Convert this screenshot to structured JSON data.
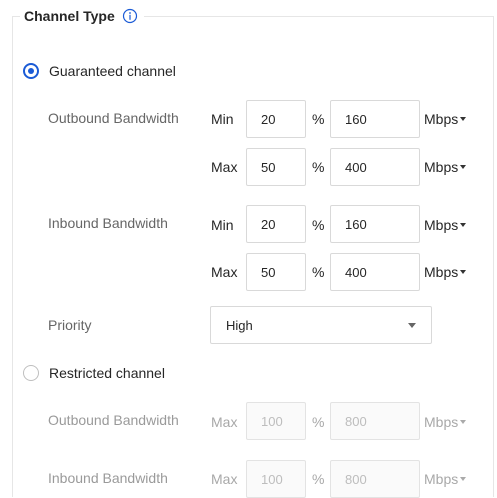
{
  "section": {
    "title": "Channel Type",
    "info_icon": "info-icon"
  },
  "guaranteed": {
    "label": "Guaranteed channel",
    "selected": true,
    "outbound": {
      "label": "Outbound Bandwidth",
      "min": {
        "label": "Min",
        "percent": "20",
        "percent_sign": "%",
        "value": "160",
        "unit": "Mbps"
      },
      "max": {
        "label": "Max",
        "percent": "50",
        "percent_sign": "%",
        "value": "400",
        "unit": "Mbps"
      }
    },
    "inbound": {
      "label": "Inbound Bandwidth",
      "min": {
        "label": "Min",
        "percent": "20",
        "percent_sign": "%",
        "value": "160",
        "unit": "Mbps"
      },
      "max": {
        "label": "Max",
        "percent": "50",
        "percent_sign": "%",
        "value": "400",
        "unit": "Mbps"
      }
    },
    "priority": {
      "label": "Priority",
      "value": "High"
    }
  },
  "restricted": {
    "label": "Restricted channel",
    "selected": false,
    "outbound": {
      "label": "Outbound Bandwidth",
      "max": {
        "label": "Max",
        "percent": "100",
        "percent_sign": "%",
        "value": "800",
        "unit": "Mbps"
      }
    },
    "inbound": {
      "label": "Inbound Bandwidth",
      "max": {
        "label": "Max",
        "percent": "100",
        "percent_sign": "%",
        "value": "800",
        "unit": "Mbps"
      }
    }
  },
  "colors": {
    "accent": "#1b5bd6",
    "border": "#d9d9d9",
    "muted_text": "#666666"
  }
}
